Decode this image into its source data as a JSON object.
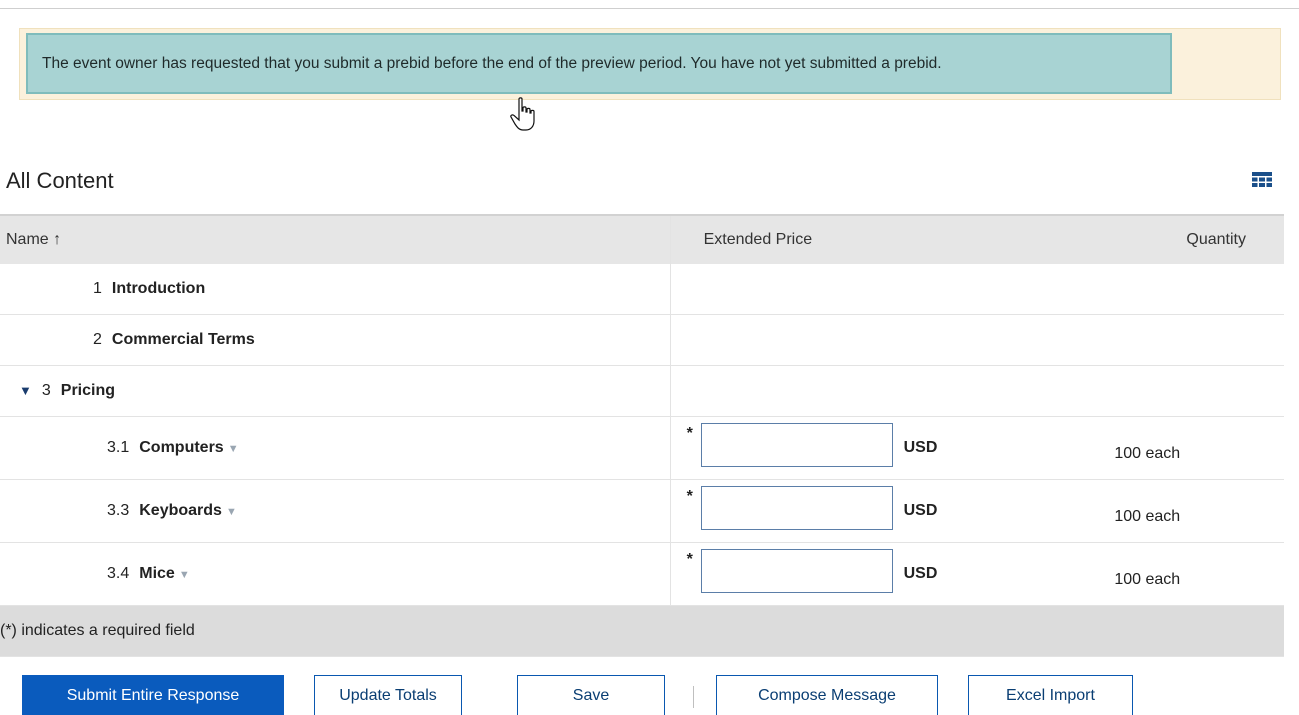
{
  "notice": {
    "message": "The event owner has requested that you submit a prebid before the end of the preview period.  You have not yet submitted a prebid."
  },
  "section": {
    "title": "All Content"
  },
  "table": {
    "headers": {
      "name": "Name ↑",
      "price": "Extended Price",
      "quantity": "Quantity"
    },
    "rows": [
      {
        "num": "1",
        "label": "Introduction"
      },
      {
        "num": "2",
        "label": "Commercial Terms"
      },
      {
        "num": "3",
        "label": "Pricing",
        "toggle": "▼"
      }
    ],
    "items": [
      {
        "num": "3.1",
        "label": "Computers",
        "currency": "USD",
        "quantity": "100 each",
        "value": "",
        "required_mark": "*"
      },
      {
        "num": "3.3",
        "label": "Keyboards",
        "currency": "USD",
        "quantity": "100 each",
        "value": "",
        "required_mark": "*"
      },
      {
        "num": "3.4",
        "label": "Mice",
        "currency": "USD",
        "quantity": "100 each",
        "value": "",
        "required_mark": "*"
      }
    ],
    "footer_note": "(*) indicates a required field"
  },
  "actions": {
    "submit": "Submit Entire Response",
    "update": "Update Totals",
    "save": "Save",
    "compose": "Compose Message",
    "excel": "Excel Import"
  },
  "icons": {
    "cursor": "hand-pointer-icon",
    "table_options": "table-grid-icon",
    "item_menu": "chevron-down-icon",
    "expand": "triangle-down-icon"
  },
  "colors": {
    "notice_bg": "#a8d3d3",
    "notice_outer": "#fbf1dc",
    "primary": "#0a5bbd",
    "header_bg": "#e6e6e6"
  }
}
